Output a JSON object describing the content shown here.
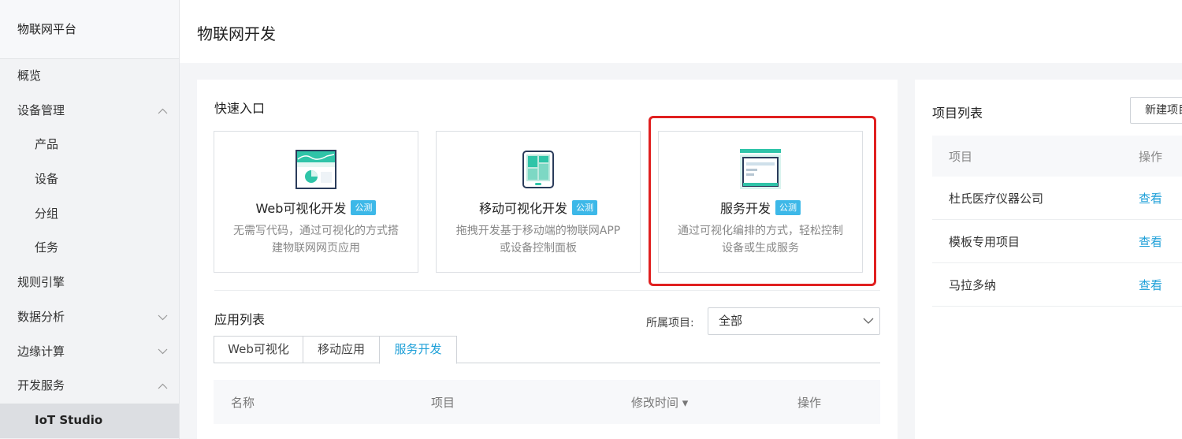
{
  "sidebar": {
    "brand": "物联网平台",
    "items": [
      {
        "label": "概览"
      },
      {
        "label": "设备管理"
      },
      {
        "label": "产品"
      },
      {
        "label": "设备"
      },
      {
        "label": "分组"
      },
      {
        "label": "任务"
      },
      {
        "label": "规则引擎"
      },
      {
        "label": "数据分析"
      },
      {
        "label": "边缘计算"
      },
      {
        "label": "开发服务"
      },
      {
        "label": "IoT Studio"
      }
    ]
  },
  "header": {
    "title": "物联网开发"
  },
  "quick_entry": {
    "title": "快速入口",
    "cards": [
      {
        "title": "Web可视化开发",
        "badge": "公测",
        "desc": "无需写代码，通过可视化的方式搭建物联网网页应用",
        "icon": "web-visual-icon"
      },
      {
        "title": "移动可视化开发",
        "badge": "公测",
        "desc": "拖拽开发基于移动端的物联网APP或设备控制面板",
        "icon": "mobile-visual-icon"
      },
      {
        "title": "服务开发",
        "badge": "公测",
        "desc": "通过可视化编排的方式，轻松控制设备或生成服务",
        "icon": "service-dev-icon"
      }
    ]
  },
  "app_list": {
    "title": "应用列表",
    "filter_label": "所属项目:",
    "filter_value": "全部",
    "tabs": [
      {
        "label": "Web可视化"
      },
      {
        "label": "移动应用"
      },
      {
        "label": "服务开发"
      }
    ],
    "columns": {
      "name": "名称",
      "project": "项目",
      "modified": "修改时间 ▾",
      "action": "操作"
    }
  },
  "project_list": {
    "title": "项目列表",
    "new_button": "新建项目",
    "columns": {
      "project": "项目",
      "action": "操作"
    },
    "rows": [
      {
        "name": "杜氏医疗仪器公司",
        "action": "查看"
      },
      {
        "name": "模板专用项目",
        "action": "查看"
      },
      {
        "name": "马拉多纳",
        "action": "查看"
      }
    ]
  },
  "colors": {
    "accent": "#1fa0d8",
    "badge": "#3db8e8",
    "highlight": "#e02020"
  }
}
